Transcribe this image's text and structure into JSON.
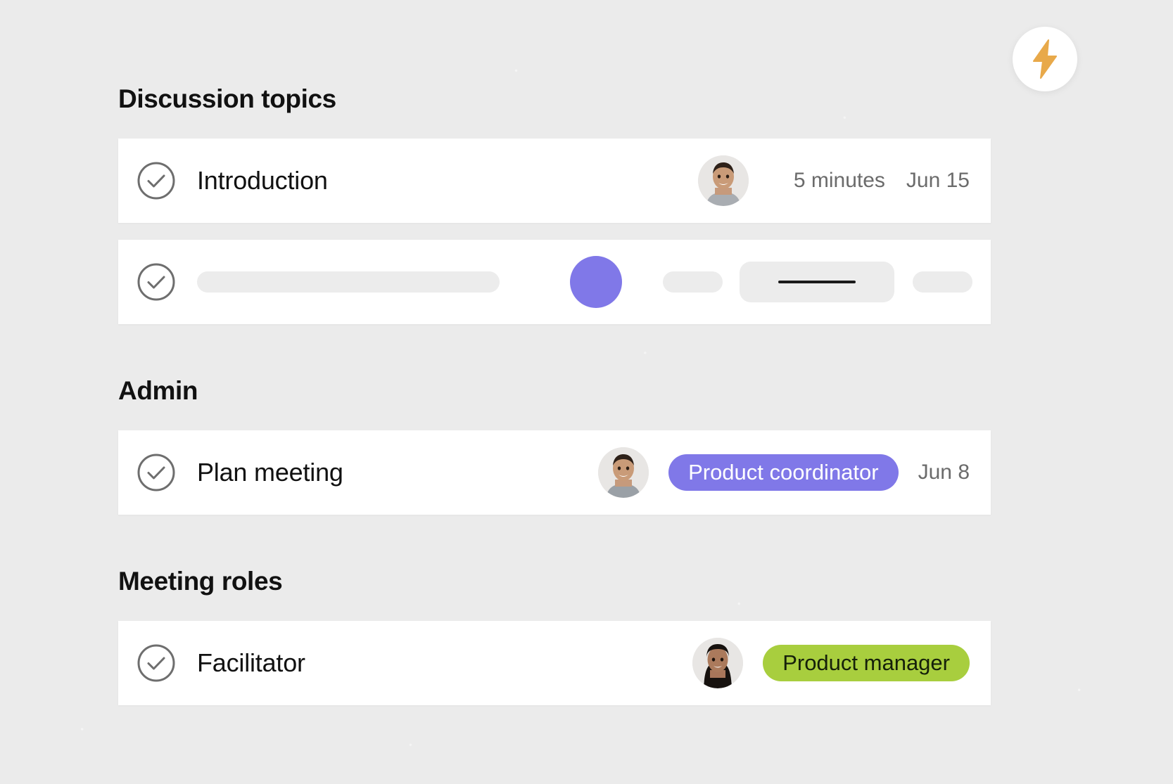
{
  "fab": {
    "name": "lightning-bolt-action-button",
    "icon": "lightning-bolt-icon",
    "icon_color": "#e8a94a",
    "background": "#ffffff"
  },
  "theme": {
    "page_background": "#ebebeb",
    "card_background": "#ffffff",
    "purple_accent": "#8078e8",
    "green_accent": "#a8ce3e",
    "text_primary": "#111111",
    "text_muted": "#6b6b6b",
    "skeleton_gray": "#ececec"
  },
  "sections": [
    {
      "title": "Discussion topics",
      "rows": [
        {
          "type": "task",
          "checkbox_icon": "check-circle-icon",
          "label": "Introduction",
          "avatar": "avatar-man-short-hair",
          "duration": "5 minutes",
          "date": "Jun 15"
        },
        {
          "type": "skeleton",
          "checkbox_icon": "check-circle-icon",
          "placeholder_bar_width": 430,
          "accent_dot_color": "#8078e8",
          "chip_small_width": 85,
          "chip_large_width": 220,
          "chip_trailing_width": 85
        }
      ]
    },
    {
      "title": "Admin",
      "rows": [
        {
          "type": "task",
          "checkbox_icon": "check-circle-icon",
          "label": "Plan meeting",
          "avatar": "avatar-man-short-hair",
          "badge": "Product coordinator",
          "badge_style": "purple",
          "date": "Jun 8"
        }
      ]
    },
    {
      "title": "Meeting roles",
      "rows": [
        {
          "type": "task",
          "checkbox_icon": "check-circle-icon",
          "label": "Facilitator",
          "avatar": "avatar-woman-long-hair",
          "badge": "Product manager",
          "badge_style": "green"
        }
      ]
    }
  ]
}
